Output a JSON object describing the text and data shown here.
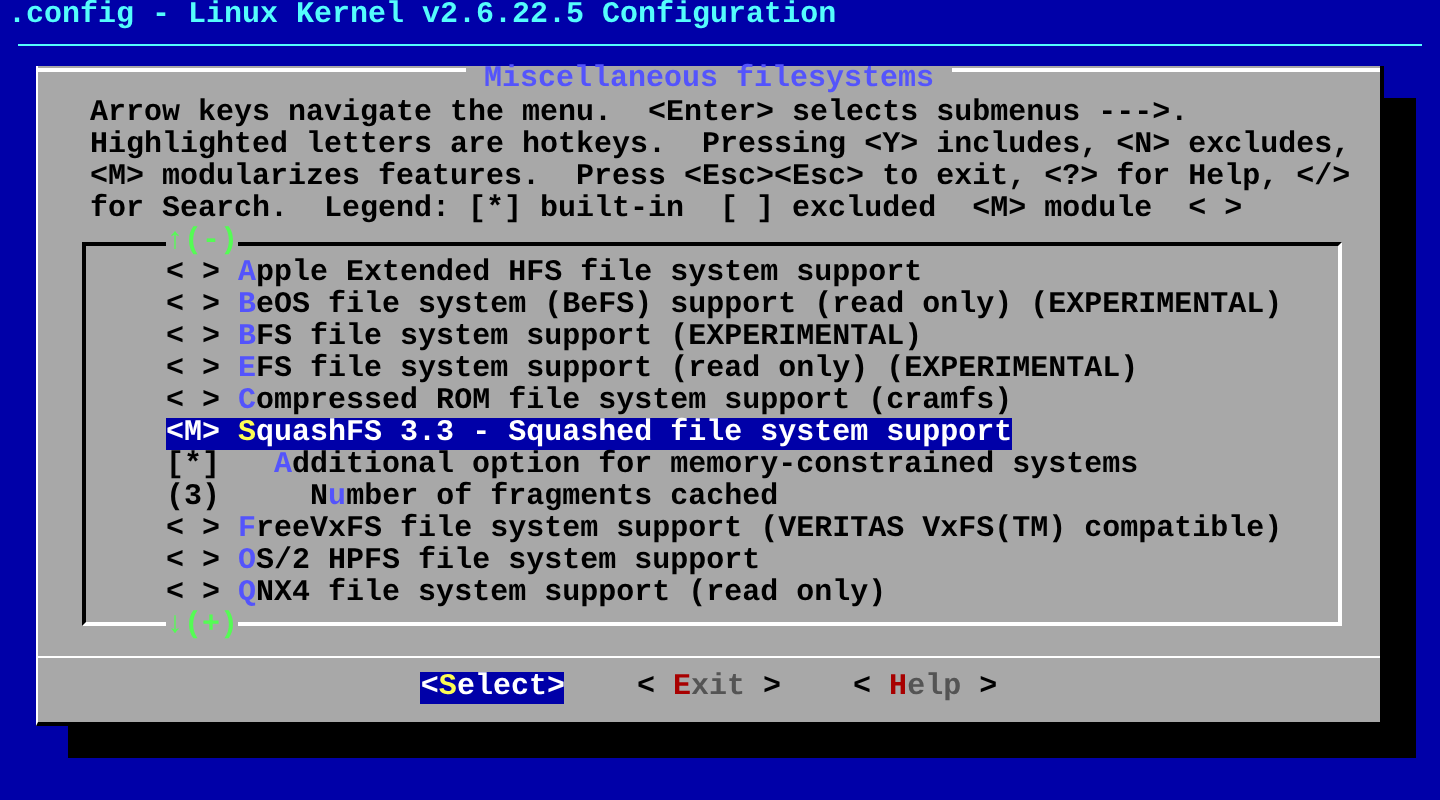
{
  "window": {
    "title": ".config - Linux Kernel v2.6.22.5 Configuration"
  },
  "dialog": {
    "title": "Miscellaneous filesystems",
    "help_lines": [
      "Arrow keys navigate the menu.  <Enter> selects submenus --->.",
      "Highlighted letters are hotkeys.  Pressing <Y> includes, <N> excludes,",
      "<M> modularizes features.  Press <Esc><Esc> to exit, <?> for Help, </>",
      "for Search.  Legend: [*] built-in  [ ] excluded  <M> module  < >"
    ]
  },
  "menu": {
    "scroll_up": "↑(-)",
    "scroll_down": "↓(+)",
    "items": [
      {
        "prefix": "< >",
        "hotkey": "A",
        "text": "pple Extended HFS file system support",
        "selected": false
      },
      {
        "prefix": "< >",
        "hotkey": "B",
        "text": "eOS file system (BeFS) support (read only) (EXPERIMENTAL)",
        "selected": false
      },
      {
        "prefix": "< >",
        "hotkey": "B",
        "text": "FS file system support (EXPERIMENTAL)",
        "selected": false
      },
      {
        "prefix": "< >",
        "hotkey": "E",
        "text": "FS file system support (read only) (EXPERIMENTAL)",
        "selected": false
      },
      {
        "prefix": "< >",
        "hotkey": "C",
        "text": "ompressed ROM file system support (cramfs)",
        "selected": false
      },
      {
        "prefix": "<M>",
        "hotkey": "S",
        "text": "quashFS 3.3 - Squashed file system support",
        "selected": true,
        "children": [
          {
            "prefix": "[*]",
            "hotkey": "A",
            "text": "dditional option for memory-constrained systems",
            "selected": false,
            "children": [
              {
                "prefix": "(3)",
                "lead": "N",
                "hotkey": "u",
                "text": "mber of fragments cached",
                "selected": false
              }
            ]
          }
        ]
      },
      {
        "prefix": "< >",
        "hotkey": "F",
        "text": "reeVxFS file system support (VERITAS VxFS(TM) compatible)",
        "selected": false
      },
      {
        "prefix": "< >",
        "hotkey": "O",
        "text": "S/2 HPFS file system support",
        "selected": false
      },
      {
        "prefix": "< >",
        "hotkey": "Q",
        "text": "NX4 file system support (read only)",
        "selected": false
      }
    ]
  },
  "buttons": [
    {
      "left": "<",
      "hotkey": "S",
      "text": "elect",
      "right": ">",
      "selected": true
    },
    {
      "left": "< ",
      "hotkey": "E",
      "text": "xit",
      "right": " >",
      "selected": false
    },
    {
      "left": "< ",
      "hotkey": "H",
      "text": "elp",
      "right": " >",
      "selected": false
    }
  ]
}
